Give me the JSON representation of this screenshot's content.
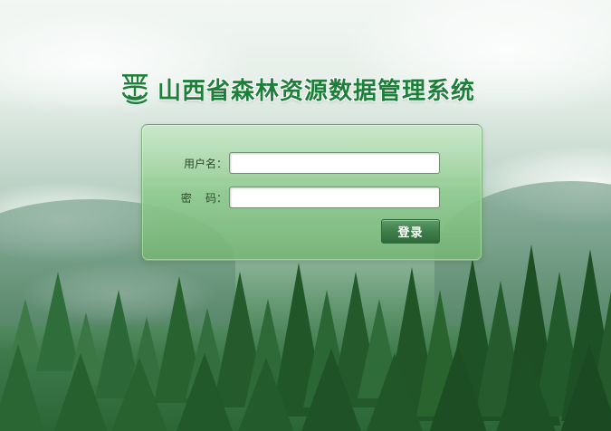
{
  "header": {
    "title": "山西省森林资源数据管理系统",
    "logo_icon": "forestry-emblem-icon"
  },
  "login_form": {
    "username_label": "用户名：",
    "username_value": "",
    "password_label": "密    码：",
    "password_value": "",
    "submit_label": "登录"
  },
  "colors": {
    "title_green": "#1e7f3a",
    "panel_green": "#8cc88c",
    "button_green": "#3f7f4b"
  }
}
